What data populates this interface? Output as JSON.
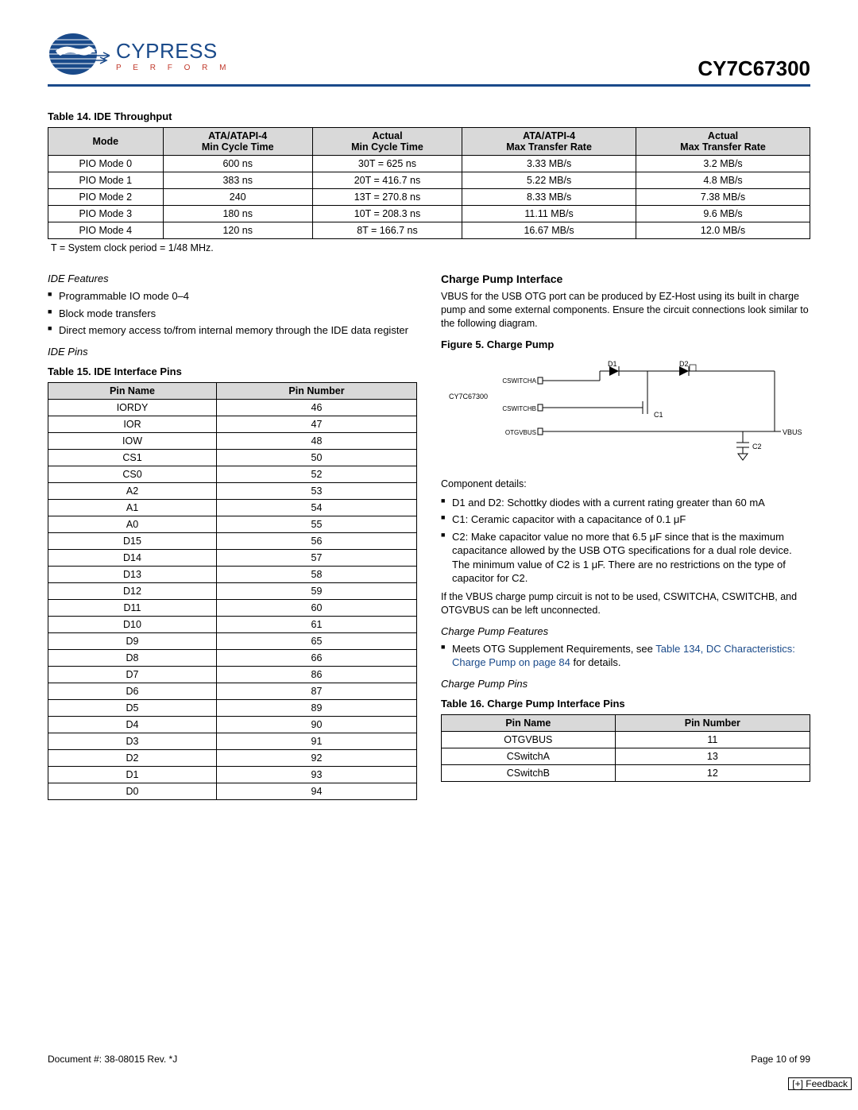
{
  "header": {
    "brand": "CYPRESS",
    "tagline": "P E R F O R M",
    "part_number": "CY7C67300"
  },
  "table14": {
    "caption": "Table 14.  IDE Throughput",
    "headers": [
      "Mode",
      "ATA/ATAPI-4\nMin Cycle Time",
      "Actual\nMin Cycle Time",
      "ATA/ATPI-4\nMax Transfer Rate",
      "Actual\nMax Transfer Rate"
    ],
    "rows": [
      [
        "PIO Mode 0",
        "600 ns",
        "30T = 625 ns",
        "3.33 MB/s",
        "3.2 MB/s"
      ],
      [
        "PIO Mode 1",
        "383 ns",
        "20T = 416.7 ns",
        "5.22 MB/s",
        "4.8 MB/s"
      ],
      [
        "PIO Mode 2",
        "240",
        "13T = 270.8 ns",
        "8.33 MB/s",
        "7.38 MB/s"
      ],
      [
        "PIO Mode 3",
        "180 ns",
        "10T = 208.3 ns",
        "11.11 MB/s",
        "9.6 MB/s"
      ],
      [
        "PIO Mode 4",
        "120 ns",
        "8T = 166.7 ns",
        "16.67 MB/s",
        "12.0 MB/s"
      ]
    ],
    "footnote": " T = System clock period = 1/48 MHz."
  },
  "left": {
    "ide_features_title": "IDE Features",
    "ide_features": [
      "Programmable IO mode 0–4",
      "Block mode transfers",
      "Direct memory access to/from internal memory through the IDE data register"
    ],
    "ide_pins_title": "IDE Pins",
    "table15": {
      "caption": "Table 15.  IDE Interface Pins",
      "headers": [
        "Pin Name",
        "Pin Number"
      ],
      "rows": [
        [
          "IORDY",
          "46"
        ],
        [
          "IOR",
          "47"
        ],
        [
          "IOW",
          "48"
        ],
        [
          "CS1",
          "50"
        ],
        [
          "CS0",
          "52"
        ],
        [
          "A2",
          "53"
        ],
        [
          "A1",
          "54"
        ],
        [
          "A0",
          "55"
        ],
        [
          "D15",
          "56"
        ],
        [
          "D14",
          "57"
        ],
        [
          "D13",
          "58"
        ],
        [
          "D12",
          "59"
        ],
        [
          "D11",
          "60"
        ],
        [
          "D10",
          "61"
        ],
        [
          "D9",
          "65"
        ],
        [
          "D8",
          "66"
        ],
        [
          "D7",
          "86"
        ],
        [
          "D6",
          "87"
        ],
        [
          "D5",
          "89"
        ],
        [
          "D4",
          "90"
        ],
        [
          "D3",
          "91"
        ],
        [
          "D2",
          "92"
        ],
        [
          "D1",
          "93"
        ],
        [
          "D0",
          "94"
        ]
      ]
    }
  },
  "right": {
    "cp_title": "Charge Pump Interface",
    "cp_intro": "VBUS for the USB OTG port can be produced by EZ-Host using its built in charge pump and some external components. Ensure the circuit connections look similar to the following diagram.",
    "fig5_caption": "Figure 5.  Charge Pump",
    "fig5_labels": {
      "chip": "CY7C67300",
      "pin_a": "CSWITCHA",
      "pin_b": "CSWITCHB",
      "pin_v": "OTGVBUS",
      "d1": "D1",
      "d2": "D2",
      "c1": "C1",
      "c2": "C2",
      "vbus": "VBUS"
    },
    "component_title": "Component details:",
    "components": [
      "D1 and D2: Schottky diodes with a current rating greater than 60 mA",
      "C1: Ceramic capacitor with a capacitance of 0.1 μF",
      "C2: Make capacitor value no more that 6.5 μF since that is the maximum capacitance allowed by the USB OTG specifications for a dual role device. The minimum value of C2 is 1 μF. There are no restrictions on the type of capacitor for C2."
    ],
    "cp_note": "If the VBUS charge pump circuit is not to be used, CSWITCHA, CSWITCHB, and OTGVBUS can be left unconnected.",
    "cp_feat_title": "Charge Pump Features",
    "cp_feat_item_prefix": "Meets OTG Supplement Requirements, see ",
    "cp_feat_link": "Table 134, DC Characteristics: Charge Pump on page 84",
    "cp_feat_item_suffix": " for details.",
    "cp_pins_title": "Charge Pump Pins",
    "table16": {
      "caption": "Table 16.  Charge Pump Interface Pins",
      "headers": [
        "Pin Name",
        "Pin Number"
      ],
      "rows": [
        [
          "OTGVBUS",
          "11"
        ],
        [
          "CSwitchA",
          "13"
        ],
        [
          "CSwitchB",
          "12"
        ]
      ]
    }
  },
  "footer": {
    "doc": "Document #: 38-08015 Rev. *J",
    "page": "Page 10 of 99",
    "feedback": "[+] Feedback"
  }
}
